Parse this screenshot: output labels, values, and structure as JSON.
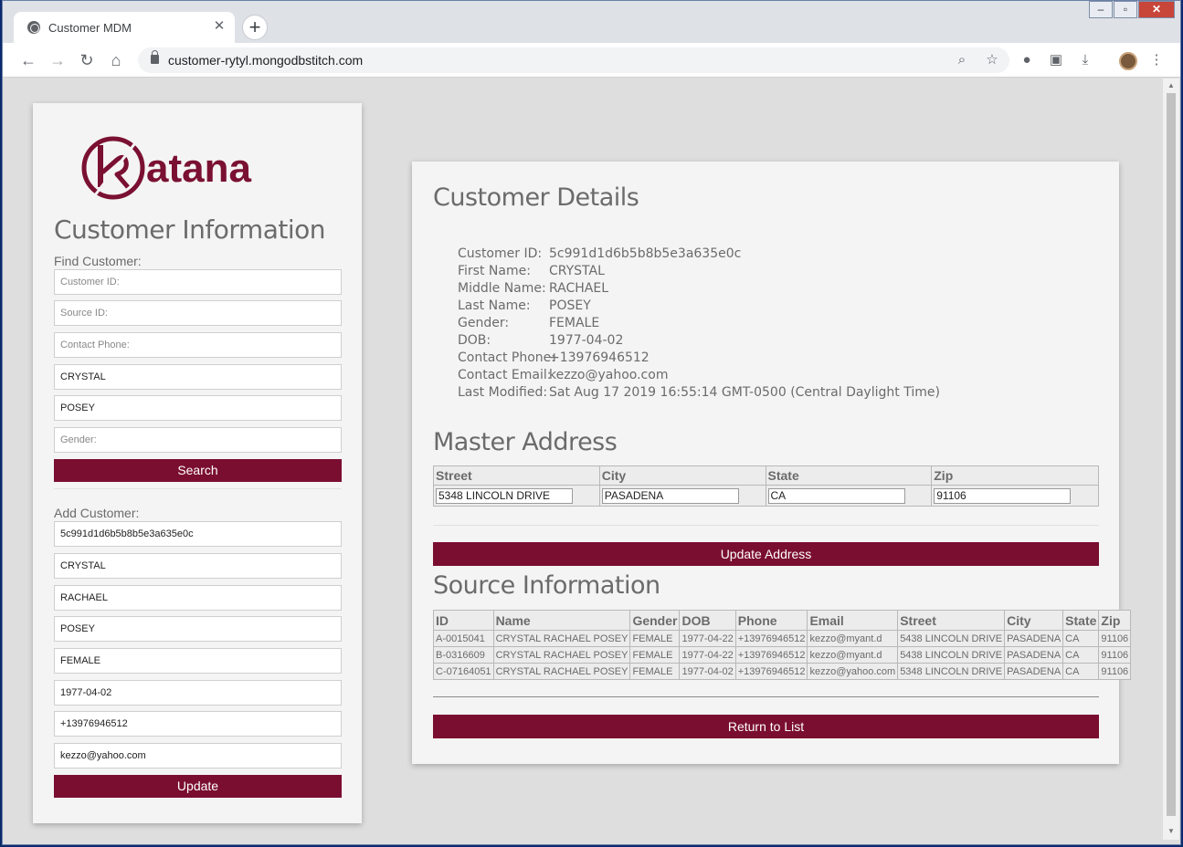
{
  "browser": {
    "tab_title": "Customer MDM",
    "url": "customer-rytyl.mongodbstitch.com"
  },
  "logo_text": "atana",
  "logo_letter": "k",
  "left": {
    "title": "Customer Information",
    "find_label": "Find Customer:",
    "find_fields": [
      {
        "placeholder": "Customer ID:",
        "value": ""
      },
      {
        "placeholder": "Source ID:",
        "value": ""
      },
      {
        "placeholder": "Contact Phone:",
        "value": ""
      },
      {
        "placeholder": "First Name:",
        "value": "CRYSTAL"
      },
      {
        "placeholder": "Last Name:",
        "value": "POSEY"
      },
      {
        "placeholder": "Gender:",
        "value": ""
      }
    ],
    "search_label": "Search",
    "add_label": "Add Customer:",
    "add_fields": [
      {
        "value": "5c991d1d6b5b8b5e3a635e0c"
      },
      {
        "value": "CRYSTAL"
      },
      {
        "value": "RACHAEL"
      },
      {
        "value": "POSEY"
      },
      {
        "value": "FEMALE"
      },
      {
        "value": "1977-04-02"
      },
      {
        "value": "+13976946512"
      },
      {
        "value": "kezzo@yahoo.com"
      }
    ],
    "update_label": "Update"
  },
  "details": {
    "title": "Customer Details",
    "rows": [
      {
        "label": "Customer ID:",
        "value": "5c991d1d6b5b8b5e3a635e0c"
      },
      {
        "label": "First Name:",
        "value": "CRYSTAL"
      },
      {
        "label": "Middle Name:",
        "value": "RACHAEL"
      },
      {
        "label": "Last Name:",
        "value": "POSEY"
      },
      {
        "label": "Gender:",
        "value": "FEMALE"
      },
      {
        "label": "DOB:",
        "value": "1977-04-02"
      },
      {
        "label": "Contact Phone:",
        "value": "+13976946512"
      },
      {
        "label": "Contact Email:",
        "value": "kezzo@yahoo.com"
      },
      {
        "label": "Last Modified:",
        "value": "Sat Aug 17 2019 16:55:14 GMT-0500 (Central Daylight Time)"
      }
    ]
  },
  "master_address": {
    "title": "Master Address",
    "headers": [
      "Street",
      "City",
      "State",
      "Zip"
    ],
    "values": [
      "5348 LINCOLN DRIVE",
      "PASADENA",
      "CA",
      "91106"
    ],
    "update_label": "Update Address"
  },
  "source": {
    "title": "Source Information",
    "headers": [
      "ID",
      "Name",
      "Gender",
      "DOB",
      "Phone",
      "Email",
      "Street",
      "City",
      "State",
      "Zip"
    ],
    "rows": [
      [
        "A-0015041",
        "CRYSTAL RACHAEL POSEY",
        "FEMALE",
        "1977-04-22",
        "+13976946512",
        "kezzo@myant.d",
        "5438 LINCOLN DRIVE",
        "PASADENA",
        "CA",
        "91106"
      ],
      [
        "B-0316609",
        "CRYSTAL RACHAEL POSEY",
        "FEMALE",
        "1977-04-22",
        "+13976946512",
        "kezzo@myant.d",
        "5438 LINCOLN DRIVE",
        "PASADENA",
        "CA",
        "91106"
      ],
      [
        "C-07164051",
        "CRYSTAL RACHAEL POSEY",
        "FEMALE",
        "1977-04-02",
        "+13976946512",
        "kezzo@yahoo.com",
        "5348 LINCOLN DRIVE",
        "PASADENA",
        "CA",
        "91106"
      ]
    ],
    "return_label": "Return to List"
  },
  "colors": {
    "brand": "#7a0e30",
    "text_muted": "#6b6b6b",
    "page_bg": "#dedede"
  }
}
